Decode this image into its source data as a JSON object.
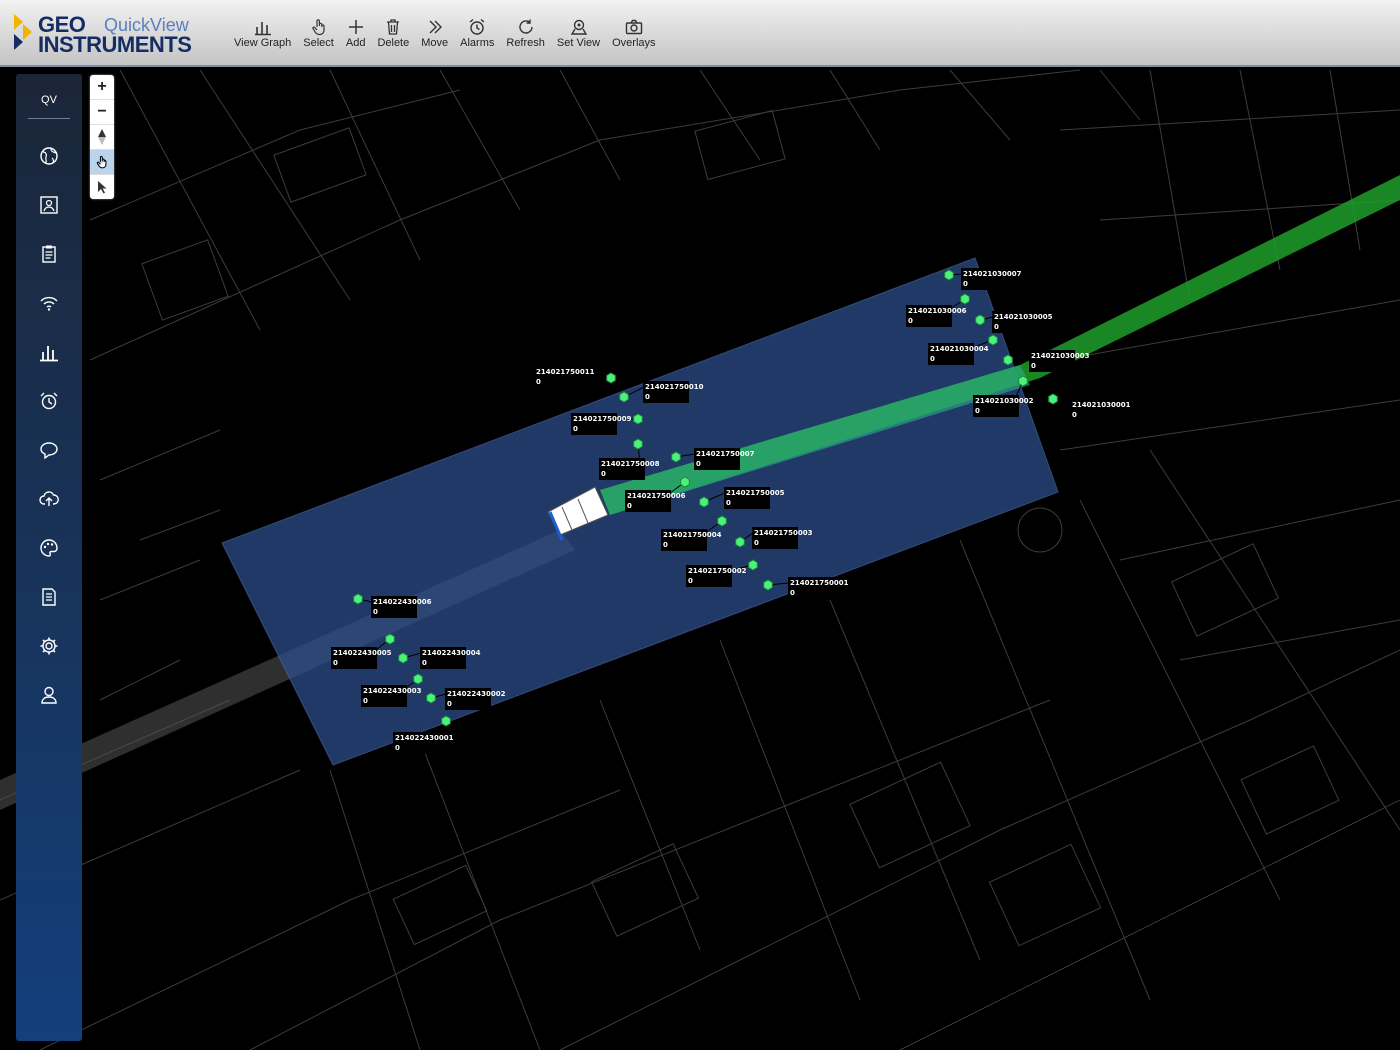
{
  "header": {
    "brand_line1": "GEO",
    "brand_line2": "INSTRUMENTS",
    "app_name": "QuickView"
  },
  "toolbar": [
    {
      "label": "View Graph",
      "icon": "bar-chart-icon"
    },
    {
      "label": "Select",
      "icon": "hand-pointer-icon"
    },
    {
      "label": "Add",
      "icon": "plus-icon"
    },
    {
      "label": "Delete",
      "icon": "trash-icon"
    },
    {
      "label": "Move",
      "icon": "double-chevron-icon"
    },
    {
      "label": "Alarms",
      "icon": "alarm-clock-icon"
    },
    {
      "label": "Refresh",
      "icon": "refresh-icon"
    },
    {
      "label": "Set View",
      "icon": "map-pin-icon"
    },
    {
      "label": "Overlays",
      "icon": "camera-icon"
    }
  ],
  "sidebar": {
    "title": "QV",
    "items": [
      "globe-icon",
      "image-icon",
      "clipboard-icon",
      "wifi-icon",
      "bar-chart-icon",
      "alarm-clock-icon",
      "chat-icon",
      "cloud-upload-icon",
      "palette-icon",
      "document-icon",
      "gear-icon",
      "user-icon"
    ]
  },
  "map_controls": [
    "+",
    "−"
  ],
  "sensors": [
    {
      "id": "214021030007",
      "value": "0"
    },
    {
      "id": "214021030006",
      "value": "0"
    },
    {
      "id": "214021030005",
      "value": "0"
    },
    {
      "id": "214021030004",
      "value": "0"
    },
    {
      "id": "214021030003",
      "value": "0"
    },
    {
      "id": "214021030002",
      "value": "0"
    },
    {
      "id": "214021030001",
      "value": "0"
    },
    {
      "id": "214021750011",
      "value": "0"
    },
    {
      "id": "214021750010",
      "value": "0"
    },
    {
      "id": "214021750009",
      "value": "0"
    },
    {
      "id": "214021750008",
      "value": "0"
    },
    {
      "id": "214021750007",
      "value": "0"
    },
    {
      "id": "214021750006",
      "value": "0"
    },
    {
      "id": "214021750005",
      "value": "0"
    },
    {
      "id": "214021750004",
      "value": "0"
    },
    {
      "id": "214021750003",
      "value": "0"
    },
    {
      "id": "214021750002",
      "value": "0"
    },
    {
      "id": "214021750001",
      "value": "0"
    },
    {
      "id": "214022430006",
      "value": "0"
    },
    {
      "id": "214022430005",
      "value": "0"
    },
    {
      "id": "214022430004",
      "value": "0"
    },
    {
      "id": "214022430003",
      "value": "0"
    },
    {
      "id": "214022430002",
      "value": "0"
    },
    {
      "id": "214022430001",
      "value": "0"
    }
  ]
}
